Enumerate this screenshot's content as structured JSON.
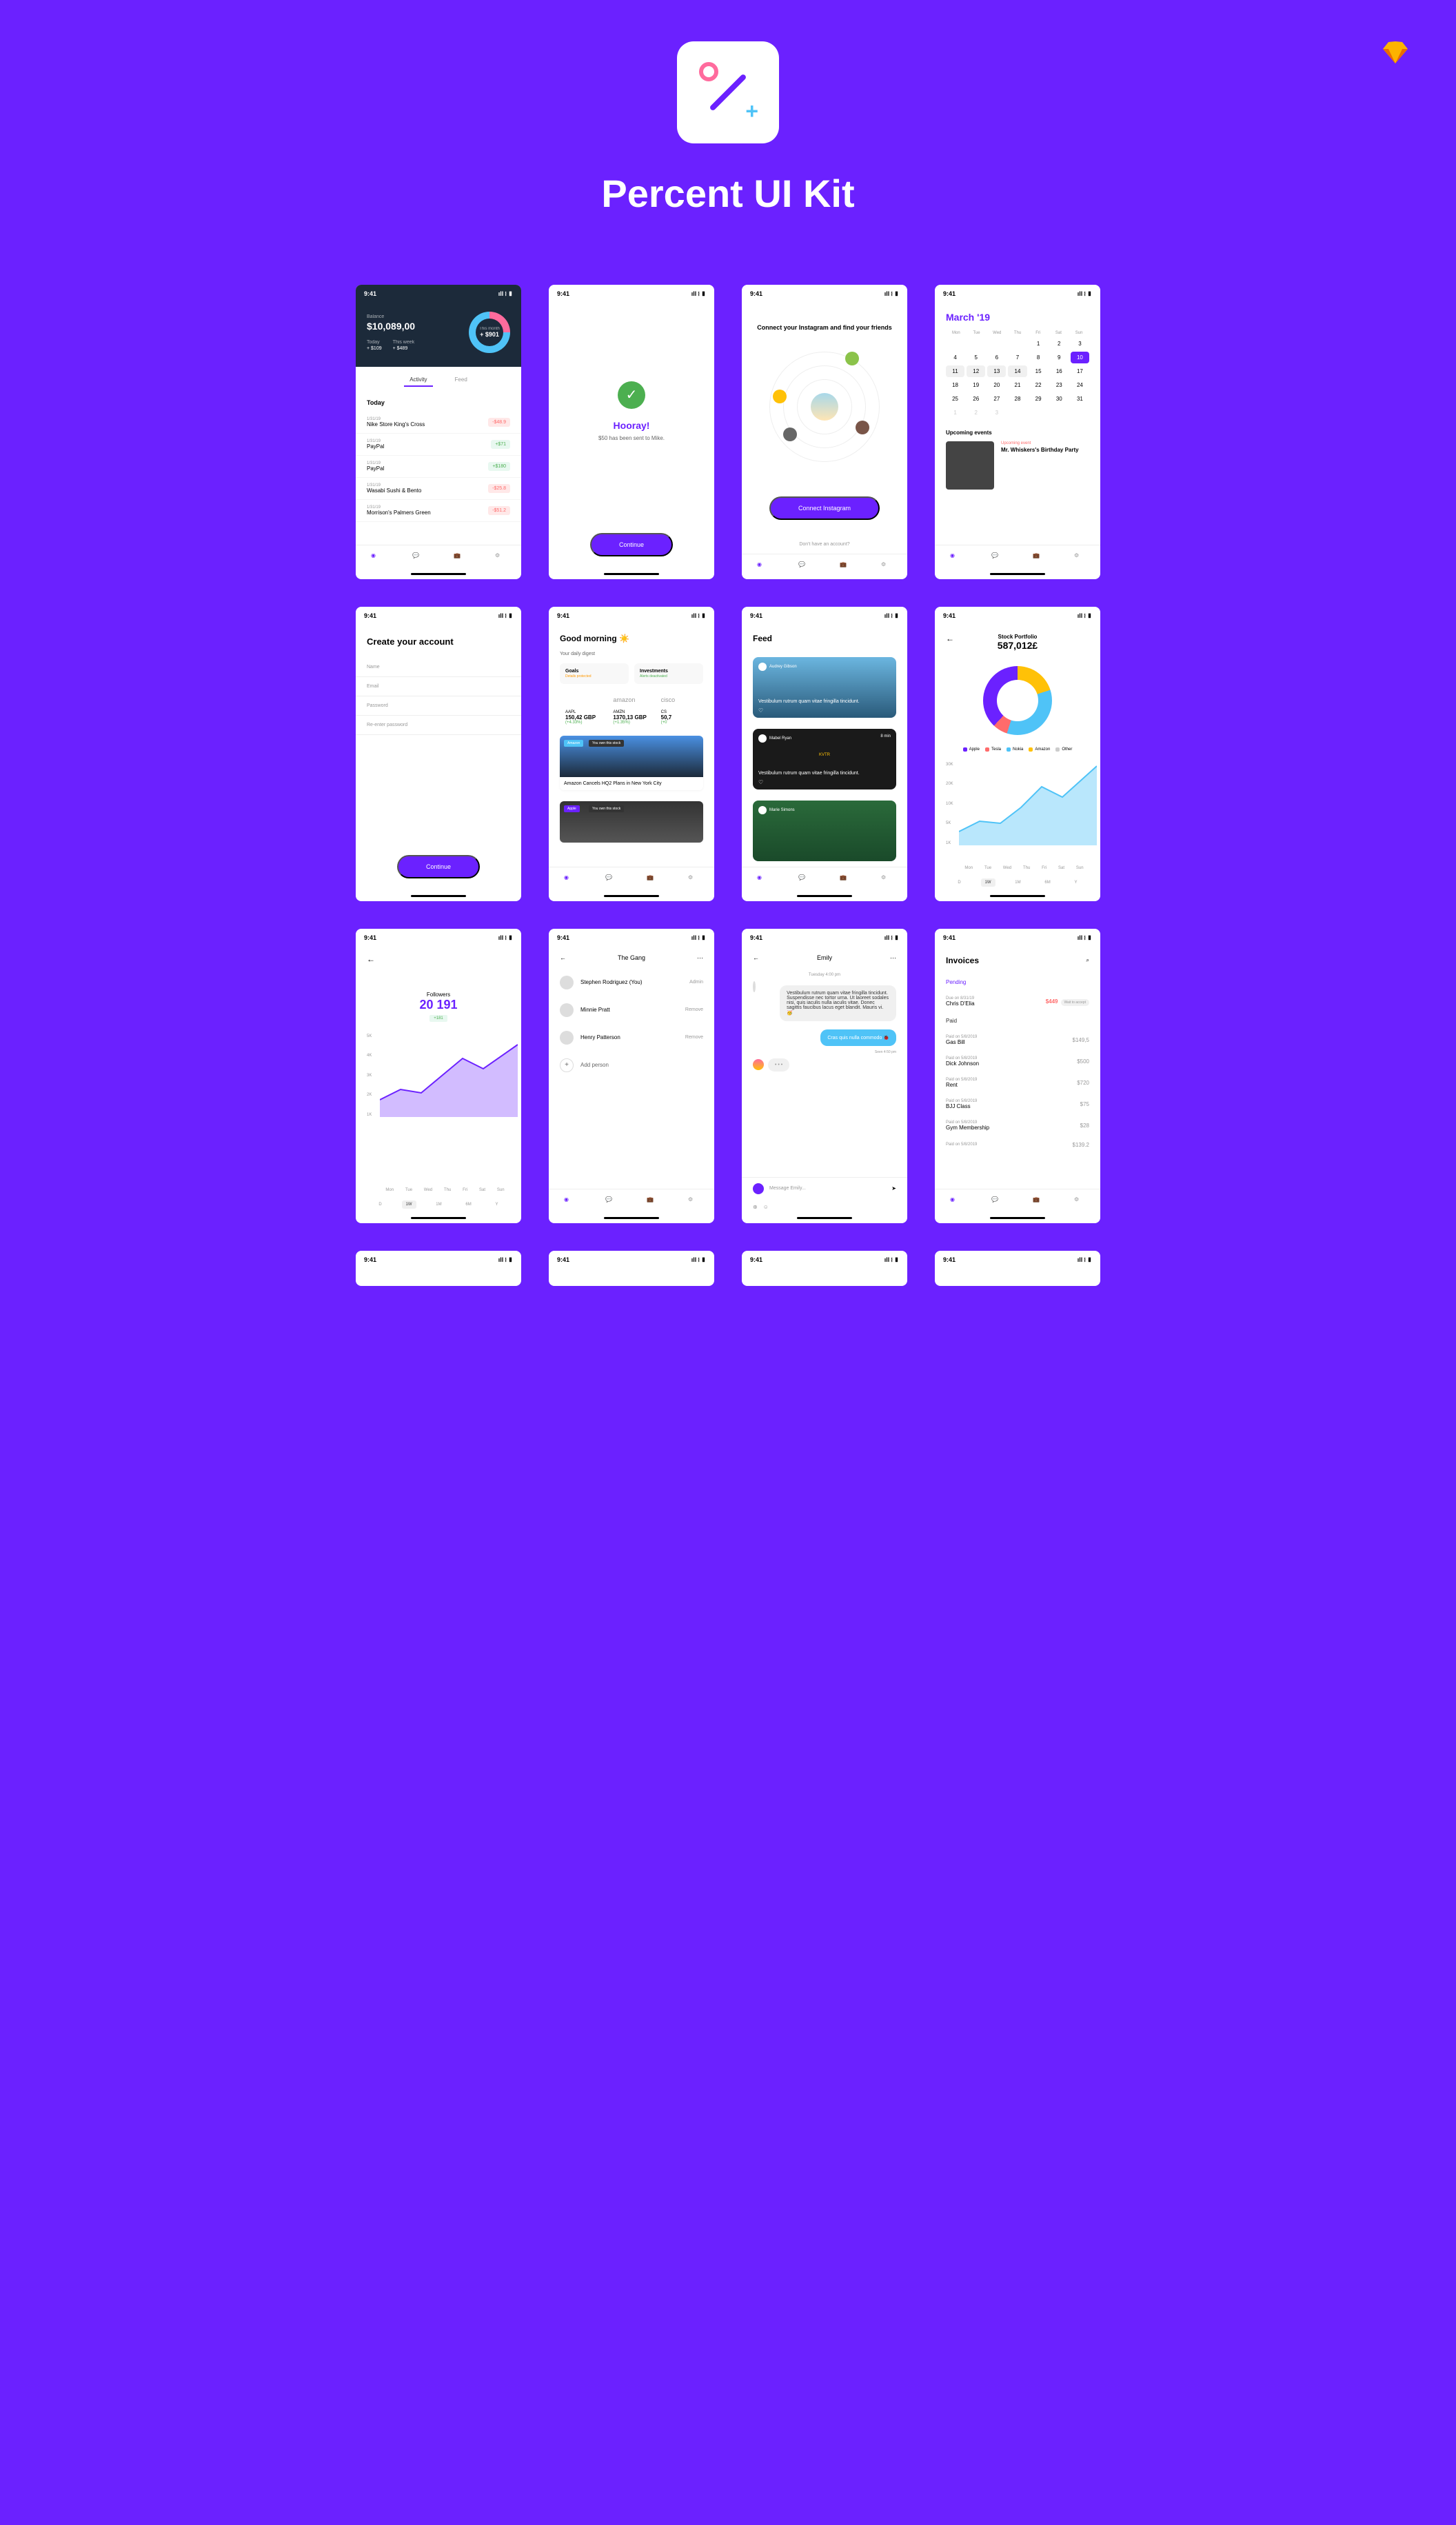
{
  "header": {
    "title": "Percent UI Kit"
  },
  "status": {
    "time": "9:41",
    "icons": "ıll ⧘ ▮"
  },
  "screen1": {
    "balance_label": "Balance",
    "balance": "$10,089,00",
    "today_label": "Today",
    "today_value": "+ $109",
    "week_label": "This week",
    "week_value": "+ $489",
    "ring_label": "This month",
    "ring_value": "+ $901",
    "tabs": [
      "Activity",
      "Feed"
    ],
    "section": "Today",
    "tx": [
      {
        "date": "1/31/19",
        "name": "Nike Store King's Cross",
        "amount": "-$48.9",
        "cls": "tx-neg"
      },
      {
        "date": "1/31/19",
        "name": "PayPal",
        "amount": "+$71",
        "cls": "tx-pos"
      },
      {
        "date": "1/31/19",
        "name": "PayPal",
        "amount": "+$180",
        "cls": "tx-pos"
      },
      {
        "date": "1/31/19",
        "name": "Wasabi Sushi & Bento",
        "amount": "-$25.8",
        "cls": "tx-neg"
      },
      {
        "date": "1/31/19",
        "name": "Morrison's Palmers Green",
        "amount": "-$51.2",
        "cls": "tx-neg"
      }
    ]
  },
  "screen2": {
    "title": "Hooray!",
    "text": "$50 has been sent to Mike.",
    "btn": "Continue"
  },
  "screen3": {
    "title": "Connect your Instagram and find your friends",
    "btn": "Connect Instagram",
    "link": "Don't have an account?"
  },
  "screen4": {
    "month": "March ",
    "year": "'19",
    "days": [
      "Mon",
      "Tue",
      "Wed",
      "Thu",
      "Fri",
      "Sat",
      "Sun"
    ],
    "events_label": "Upcoming events",
    "event_tag": "Upcoming event",
    "event_name": "Mr. Whiskers's Birthday Party"
  },
  "screen5": {
    "title": "Create your account",
    "fields": [
      "Name",
      "Email",
      "Password",
      "Re-enter password"
    ],
    "btn": "Continue"
  },
  "screen6": {
    "greeting": "Good morning ☀️",
    "digest": "Your daily digest",
    "card1_title": "Goals",
    "card2_title": "Investments",
    "card1_text": "Details protected",
    "card2_text": "Alerts deactivated",
    "stocks": [
      {
        "ticker": "AAPL",
        "price": "150,42 GBP",
        "change": "(+4.33%)"
      },
      {
        "ticker": "AMZN",
        "price": "1370,13 GBP",
        "change": "(+1.35%)"
      },
      {
        "ticker": "CS",
        "price": "50,7",
        "change": "(+0"
      }
    ],
    "badge1": "Amazon",
    "badge2": "You own this stock",
    "news1": "Amazon Cancels HQ2 Plans in New York City",
    "badge3": "Apple",
    "badge4": "You own this stock"
  },
  "screen7": {
    "title": "Feed",
    "posts": [
      {
        "author": "Audrey Gibson",
        "text": "Vestibulum rutrum quam vitae fringilla tincidunt.",
        "time": ""
      },
      {
        "author": "Mabel Ryan",
        "text": "Vestibulum rutrum quam vitae fringilla tincidunt.",
        "time": "8 min"
      },
      {
        "author": "Marie Simons",
        "text": "",
        "time": ""
      }
    ]
  },
  "screen8": {
    "label": "Stock Portfolio",
    "value": "587,012£",
    "legend": [
      {
        "name": "Apple",
        "color": "#6B21FF"
      },
      {
        "name": "Tesla",
        "color": "#FF6B6B"
      },
      {
        "name": "Nokia",
        "color": "#4FC3F7"
      },
      {
        "name": "Amazon",
        "color": "#FFC107"
      },
      {
        "name": "Other",
        "color": "#ccc"
      }
    ],
    "axis": [
      "30K",
      "20K",
      "10K",
      "5K",
      "1K"
    ],
    "days": [
      "Mon",
      "Tue",
      "Wed",
      "Thu",
      "Fri",
      "Sat",
      "Sun"
    ],
    "periods": [
      "D",
      "1W",
      "1M",
      "6M",
      "Y"
    ]
  },
  "screen9": {
    "label": "Followers",
    "count": "20 191",
    "change": "+181",
    "axis": [
      "5K",
      "4K",
      "3K",
      "2K",
      "1K"
    ],
    "days": [
      "Mon",
      "Tue",
      "Wed",
      "Thu",
      "Fri",
      "Sat",
      "Sun"
    ],
    "periods": [
      "D",
      "1W",
      "1M",
      "6M",
      "Y"
    ]
  },
  "screen10": {
    "title": "The Gang",
    "members": [
      {
        "name": "Stephen Rodriguez (You)",
        "action": "Admin"
      },
      {
        "name": "Minnie Pratt",
        "action": "Remove"
      },
      {
        "name": "Henry Patterson",
        "action": "Remove"
      }
    ],
    "add": "Add person"
  },
  "screen11": {
    "name": "Emily",
    "day": "Tuesday 4:00 pm",
    "msg1": "Vestibulum rutrum quam vitae fringilla tincidunt. Suspendisse nec tortor urna. Ut laoreet sodales nisi, quis iaculis nulla iaculis vitae. Donec sagittis faucibus lacus eget blandit. Mauris vi. 🥳",
    "msg2": "Cras quis nulla commodo 🐞",
    "seen": "Seen 4:50 pm",
    "typing": "• • •",
    "input": "Message Emily...",
    "controls": [
      "⊕",
      "☺"
    ]
  },
  "screen12": {
    "title": "Invoices",
    "pending": "Pending",
    "paid": "Paid",
    "pending_items": [
      {
        "date": "Due on 8/31/19",
        "name": "Chris D'Elia",
        "amount": "$449",
        "badge": "Wait to accept"
      }
    ],
    "paid_items": [
      {
        "date": "Paid on 5/8/2019",
        "name": "Gas Bill",
        "amount": "$149,5"
      },
      {
        "date": "Paid on 5/8/2019",
        "name": "Dick Johnson",
        "amount": "$500"
      },
      {
        "date": "Paid on 5/8/2019",
        "name": "Rent",
        "amount": "$720"
      },
      {
        "date": "Paid on 5/8/2019",
        "name": "BJJ Class",
        "amount": "$75"
      },
      {
        "date": "Paid on 5/8/2019",
        "name": "Gym Membership",
        "amount": "$28"
      },
      {
        "date": "Paid on 5/8/2019",
        "name": "",
        "amount": "$139.2"
      }
    ]
  },
  "chart_data": [
    {
      "type": "area",
      "title": "Stock Portfolio",
      "ylabel": "",
      "ylim": [
        1000,
        30000
      ],
      "categories": [
        "Mon",
        "Tue",
        "Wed",
        "Thu",
        "Fri",
        "Sat",
        "Sun"
      ],
      "values": [
        5000,
        7000,
        6500,
        12000,
        18000,
        15000,
        28000
      ]
    },
    {
      "type": "area",
      "title": "Followers",
      "ylabel": "",
      "ylim": [
        1000,
        5000
      ],
      "categories": [
        "Mon",
        "Tue",
        "Wed",
        "Thu",
        "Fri",
        "Sat",
        "Sun"
      ],
      "values": [
        1500,
        2200,
        2000,
        2800,
        3500,
        3000,
        4200
      ]
    }
  ]
}
